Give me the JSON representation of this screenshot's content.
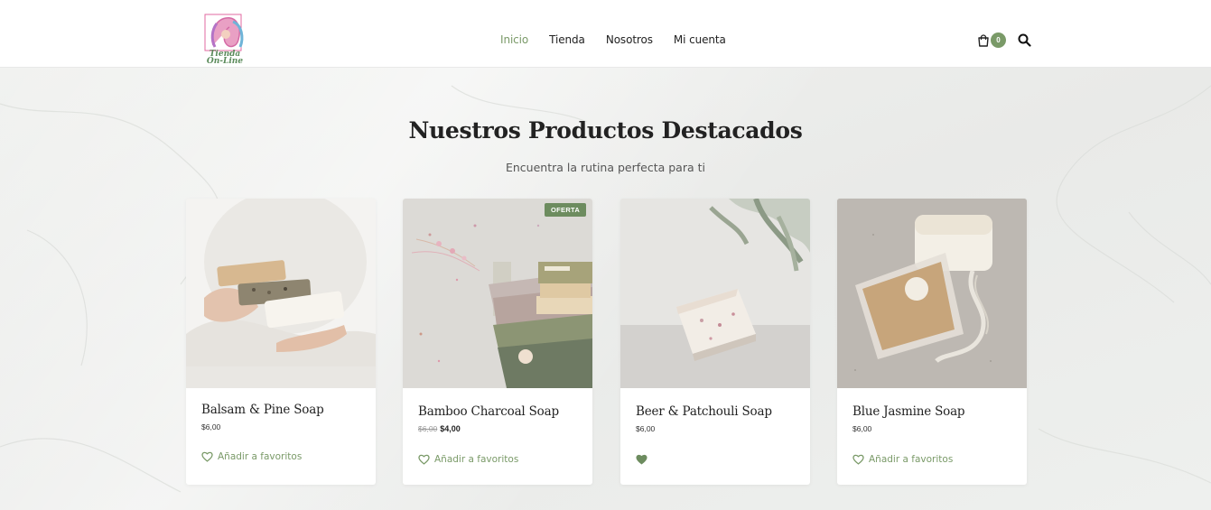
{
  "header": {
    "logo_text": "Tienda On-Line",
    "nav": [
      {
        "label": "Inicio",
        "active": true
      },
      {
        "label": "Tienda",
        "active": false
      },
      {
        "label": "Nosotros",
        "active": false
      },
      {
        "label": "Mi cuenta",
        "active": false
      }
    ],
    "cart_count": "0",
    "cart_icon": "shopping-bag-icon",
    "search_icon": "search-icon"
  },
  "section": {
    "title": "Nuestros Productos Destacados",
    "subtitle": "Encuentra la rutina perfecta para ti"
  },
  "products": [
    {
      "name": "Balsam & Pine Soap",
      "price": "$6,00",
      "old_price": "",
      "fav_label": "Añadir a favoritos",
      "favorited": false,
      "badge": ""
    },
    {
      "name": "Bamboo Charcoal Soap",
      "price": "$4,00",
      "old_price": "$6,00",
      "fav_label": "Añadir a favoritos",
      "favorited": false,
      "badge": "OFERTA"
    },
    {
      "name": "Beer & Patchouli Soap",
      "price": "$6,00",
      "old_price": "",
      "fav_label": "",
      "favorited": true,
      "badge": ""
    },
    {
      "name": "Blue Jasmine Soap",
      "price": "$6,00",
      "old_price": "",
      "fav_label": "Añadir a favoritos",
      "favorited": false,
      "badge": ""
    }
  ],
  "colors": {
    "accent": "#7a9a68",
    "badge": "#6d8c5f",
    "background": "#edeeec"
  }
}
